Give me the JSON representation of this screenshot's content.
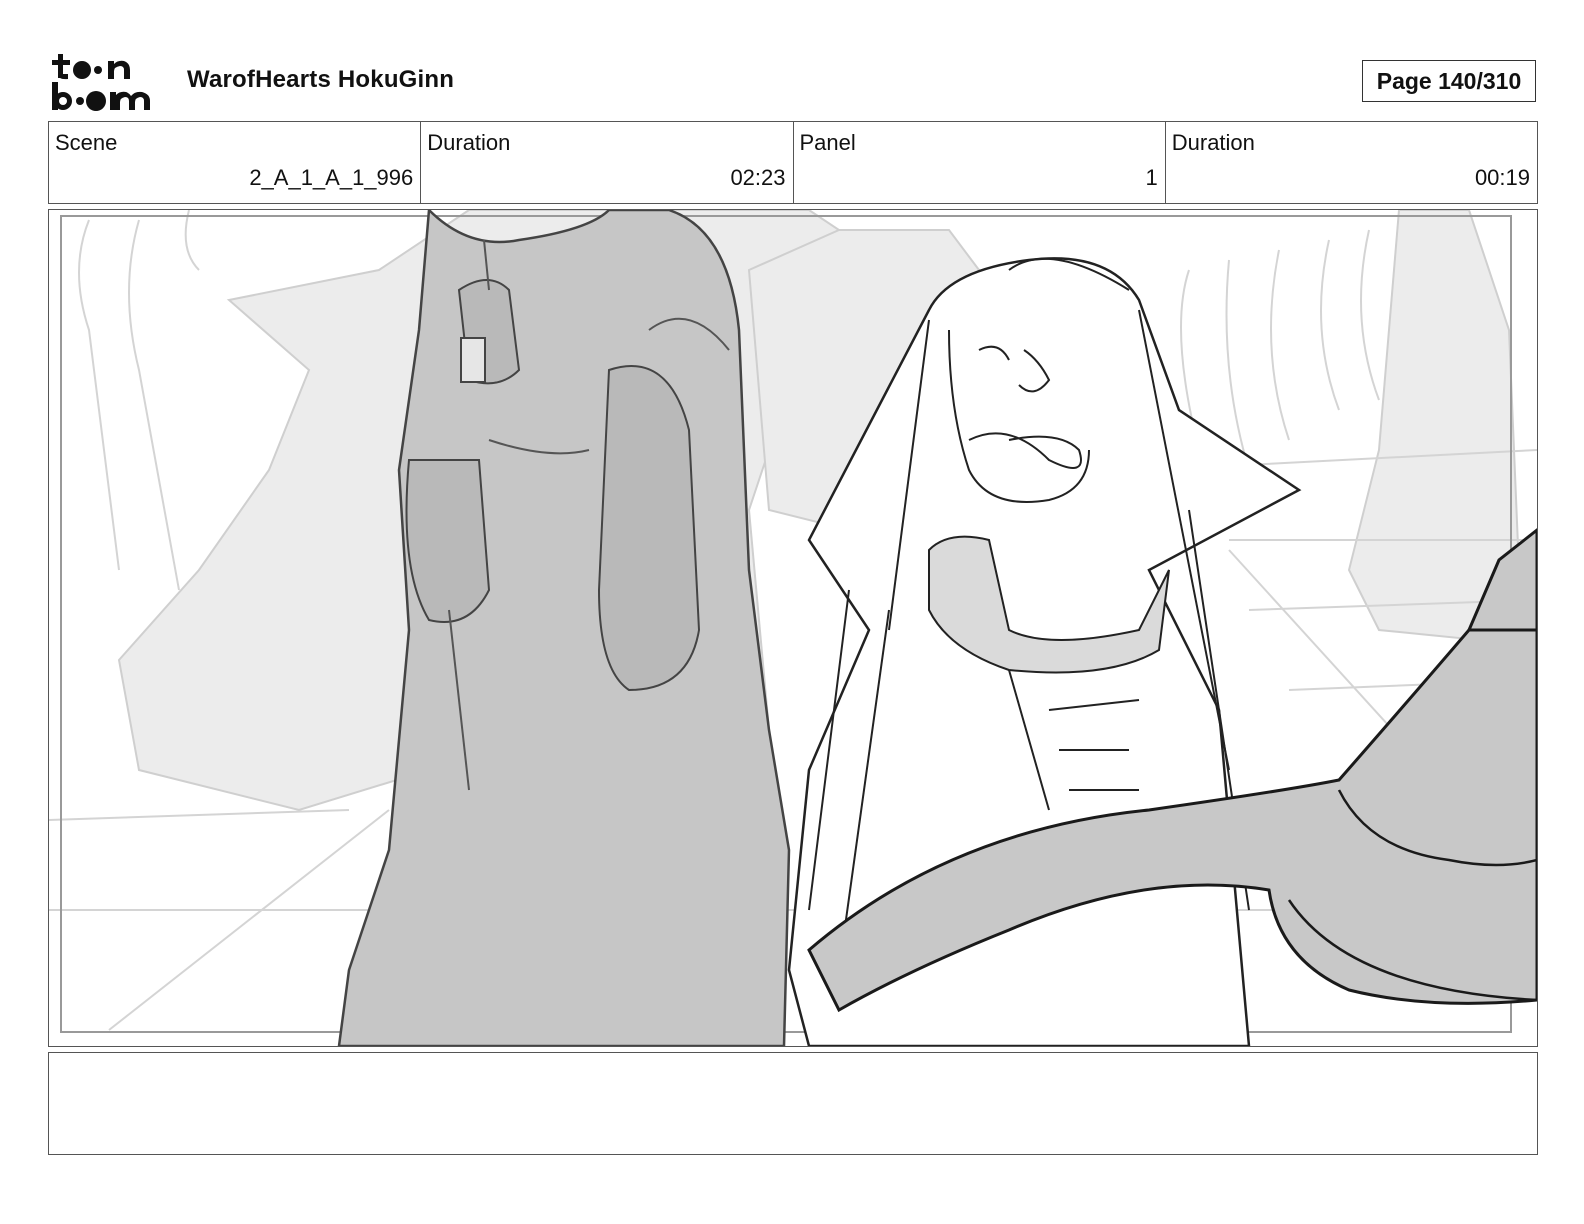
{
  "header": {
    "logo_text": "toon boom",
    "project_title": "WarofHearts HokuGinn",
    "page_label": "Page 140/310"
  },
  "info": {
    "scene_label": "Scene",
    "scene_value": "2_A_1_A_1_996",
    "scene_duration_label": "Duration",
    "scene_duration_value": "02:23",
    "panel_label": "Panel",
    "panel_value": "1",
    "panel_duration_label": "Duration",
    "panel_duration_value": "00:19"
  },
  "panel": {
    "image": "storyboard-sketch-two-robed-figures"
  },
  "notes": {
    "text": ""
  }
}
